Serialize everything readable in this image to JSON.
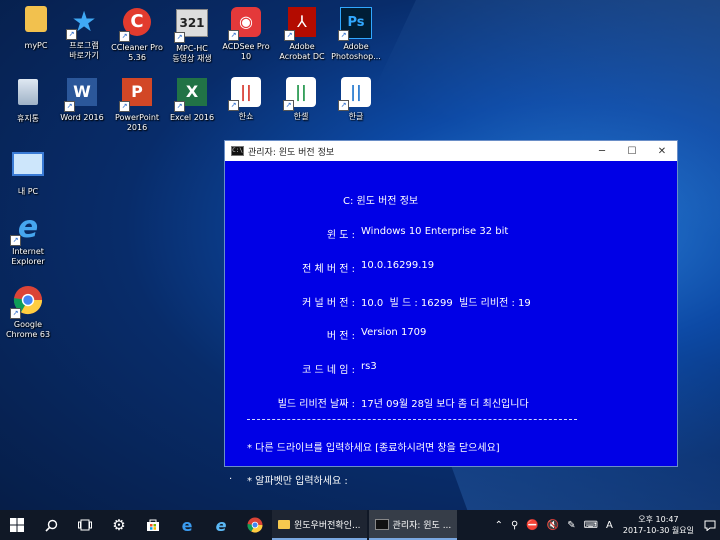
{
  "desktop_icons": [
    {
      "id": "mypc",
      "label": "myPC"
    },
    {
      "id": "program",
      "label": "프로그램\n바로가기"
    },
    {
      "id": "ccleaner",
      "label": "CCleaner Pro\n5.36"
    },
    {
      "id": "mpc",
      "label": "MPC-HC\n동영상 재생"
    },
    {
      "id": "acdsee",
      "label": "ACDSee Pro\n10"
    },
    {
      "id": "acrobat",
      "label": "Adobe\nAcrobat DC"
    },
    {
      "id": "photoshop",
      "label": "Adobe\nPhotoshop..."
    },
    {
      "id": "recycle",
      "label": "휴지통"
    },
    {
      "id": "word",
      "label": "Word 2016"
    },
    {
      "id": "powerpoint",
      "label": "PowerPoint\n2016"
    },
    {
      "id": "excel",
      "label": "Excel 2016"
    },
    {
      "id": "hanshow",
      "label": "한쇼"
    },
    {
      "id": "hancell",
      "label": "한셀"
    },
    {
      "id": "hangul",
      "label": "한글"
    },
    {
      "id": "thispc",
      "label": "내 PC"
    },
    {
      "id": "ie",
      "label": "Internet\nExplorer"
    },
    {
      "id": "chrome",
      "label": "Google\nChrome 63"
    }
  ],
  "console": {
    "title": "관리자:  윈도 버전 정보",
    "window_buttons": {
      "minimize": "─",
      "maximize": "☐",
      "close": "✕"
    },
    "heading": "C: 윈도 버전 정보",
    "rows": [
      {
        "label": "윈 도 :",
        "value": "Windows 10 Enterprise 32 bit"
      },
      {
        "label": "전 체 버 전 :",
        "value": "10.0.16299.19"
      },
      {
        "label": "커 널 버 전 :",
        "value": "10.0  빌 드 : 16299  빌드 리비전 : 19"
      },
      {
        "label": "버 전 :",
        "value": "Version 1709"
      },
      {
        "label": "코 드 네 임 :",
        "value": "rs3"
      },
      {
        "label": "빌드 리비전 날짜 :",
        "value": "17년 09월 28일 보다 좀 더 최신입니다"
      }
    ],
    "prompt1": "* 다른 드라이브를 입력하세요 [종료하시려면 창을 닫으세요]",
    "prompt2": "* 알파벳만 입력하세요 :",
    "cursor": "."
  },
  "taskbar": {
    "apps": [
      {
        "label": "윈도우버전확인..."
      },
      {
        "label": "관리자:  윈도 ..."
      }
    ],
    "clock": {
      "time": "오후 10:47",
      "date": "2017-10-30 월요일"
    },
    "colors": {
      "bg": "#101826",
      "accent": "#7aa7e0"
    }
  }
}
